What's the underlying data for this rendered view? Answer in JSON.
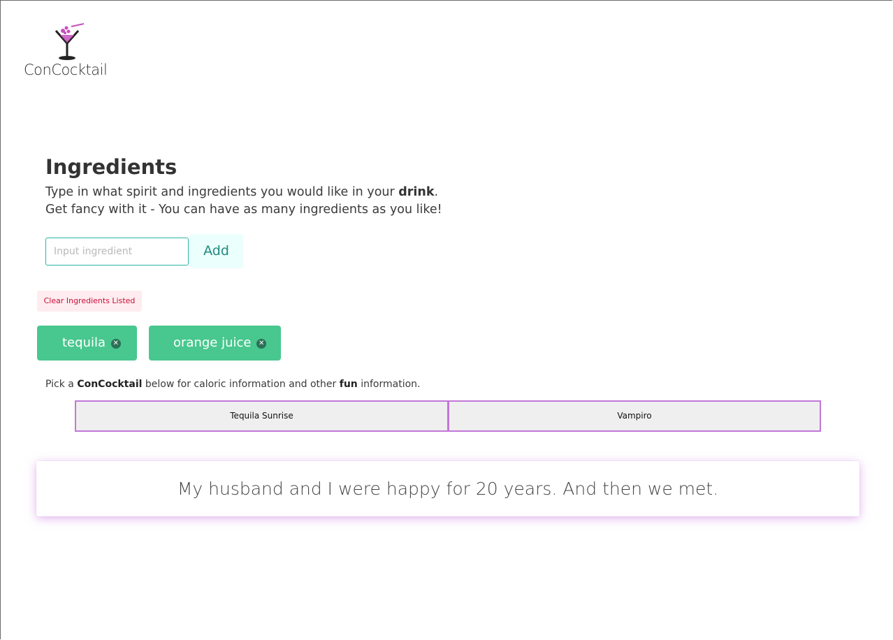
{
  "brand": {
    "name": "ConCocktail",
    "accent_color": "#c74fc0"
  },
  "ingredients_section": {
    "title": "Ingredients",
    "intro_line1_before": "Type in what spirit and ingredients you would like in your ",
    "intro_line1_bold": "drink",
    "intro_line1_after": ".",
    "intro_line2": "Get fancy with it - You can have as many ingredients as you like!"
  },
  "ingredient_input": {
    "placeholder": "Input ingredient",
    "value": ""
  },
  "add_button": {
    "label": "Add"
  },
  "clear_button": {
    "label": "Clear Ingredients Listed"
  },
  "ingredient_tags": [
    {
      "label": "tequila",
      "remove_icon": "close-circle-icon"
    },
    {
      "label": "orange juice",
      "remove_icon": "close-circle-icon"
    }
  ],
  "pick_prompt": {
    "before": "Pick a ",
    "brand": "ConCocktail",
    "middle": " below for caloric information and other ",
    "fun": "fun",
    "after": " information."
  },
  "cocktail_options": [
    {
      "label": "Tequila Sunrise"
    },
    {
      "label": "Vampiro"
    }
  ],
  "quote": {
    "text": "My husband and I were happy for 20 years. And then we met."
  },
  "colors": {
    "tag_green": "#48c78e",
    "input_border": "#2ab5a5",
    "add_button_bg": "#ebfffc",
    "clear_button_bg": "#feecf0",
    "clear_button_text": "#cc0f35",
    "option_border": "#c277d8"
  }
}
